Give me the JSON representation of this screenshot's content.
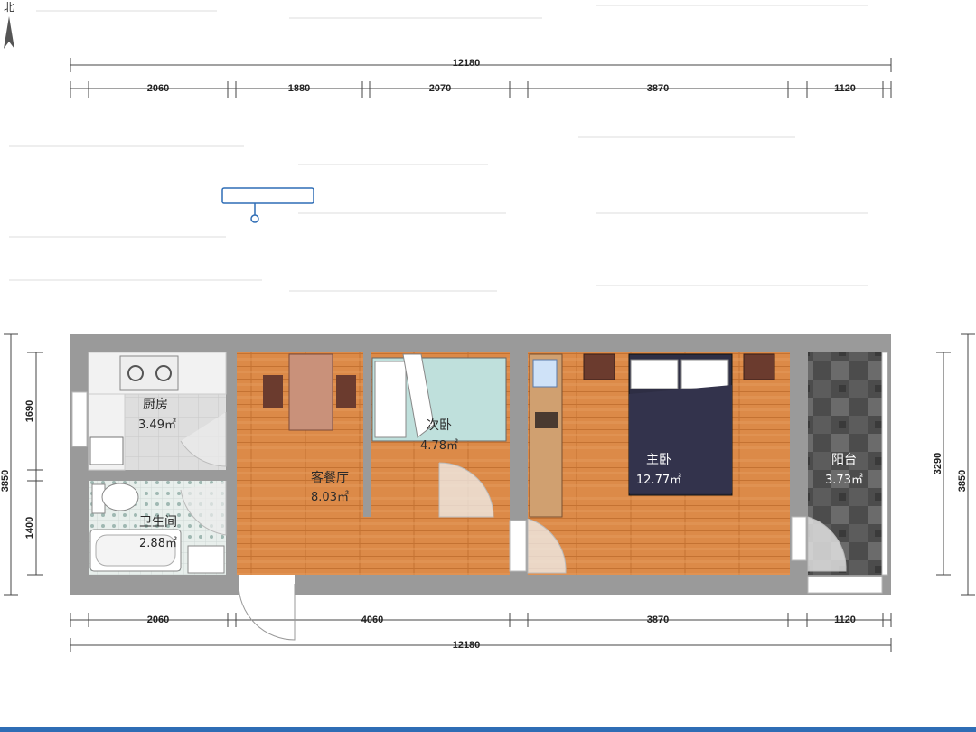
{
  "compass": {
    "label": "北"
  },
  "colors": {
    "wall": "#9a9a9a",
    "wood": "#dc8a48",
    "tile": "#dcdcdc",
    "balcony": "#555555",
    "bottom_bar": "#2f6db5"
  },
  "dimensions": {
    "top_total": "12180",
    "top_segments": [
      "2060",
      "1880",
      "2070",
      "3870",
      "1120"
    ],
    "bottom_segments": [
      "2060",
      "4060",
      "3870",
      "1120"
    ],
    "bottom_total": "12180",
    "left_segments": [
      "1690",
      "1400"
    ],
    "left_total": "3850",
    "right_segment": "3290",
    "right_total": "3850"
  },
  "rooms": {
    "kitchen": {
      "name": "厨房",
      "area": "3.49㎡"
    },
    "bathroom": {
      "name": "卫生间",
      "area": "2.88㎡"
    },
    "living": {
      "name": "客餐厅",
      "area": "8.03㎡"
    },
    "second_bedroom": {
      "name": "次卧",
      "area": "4.78㎡"
    },
    "master_bedroom": {
      "name": "主卧",
      "area": "12.77㎡"
    },
    "balcony": {
      "name": "阳台",
      "area": "3.73㎡"
    }
  }
}
